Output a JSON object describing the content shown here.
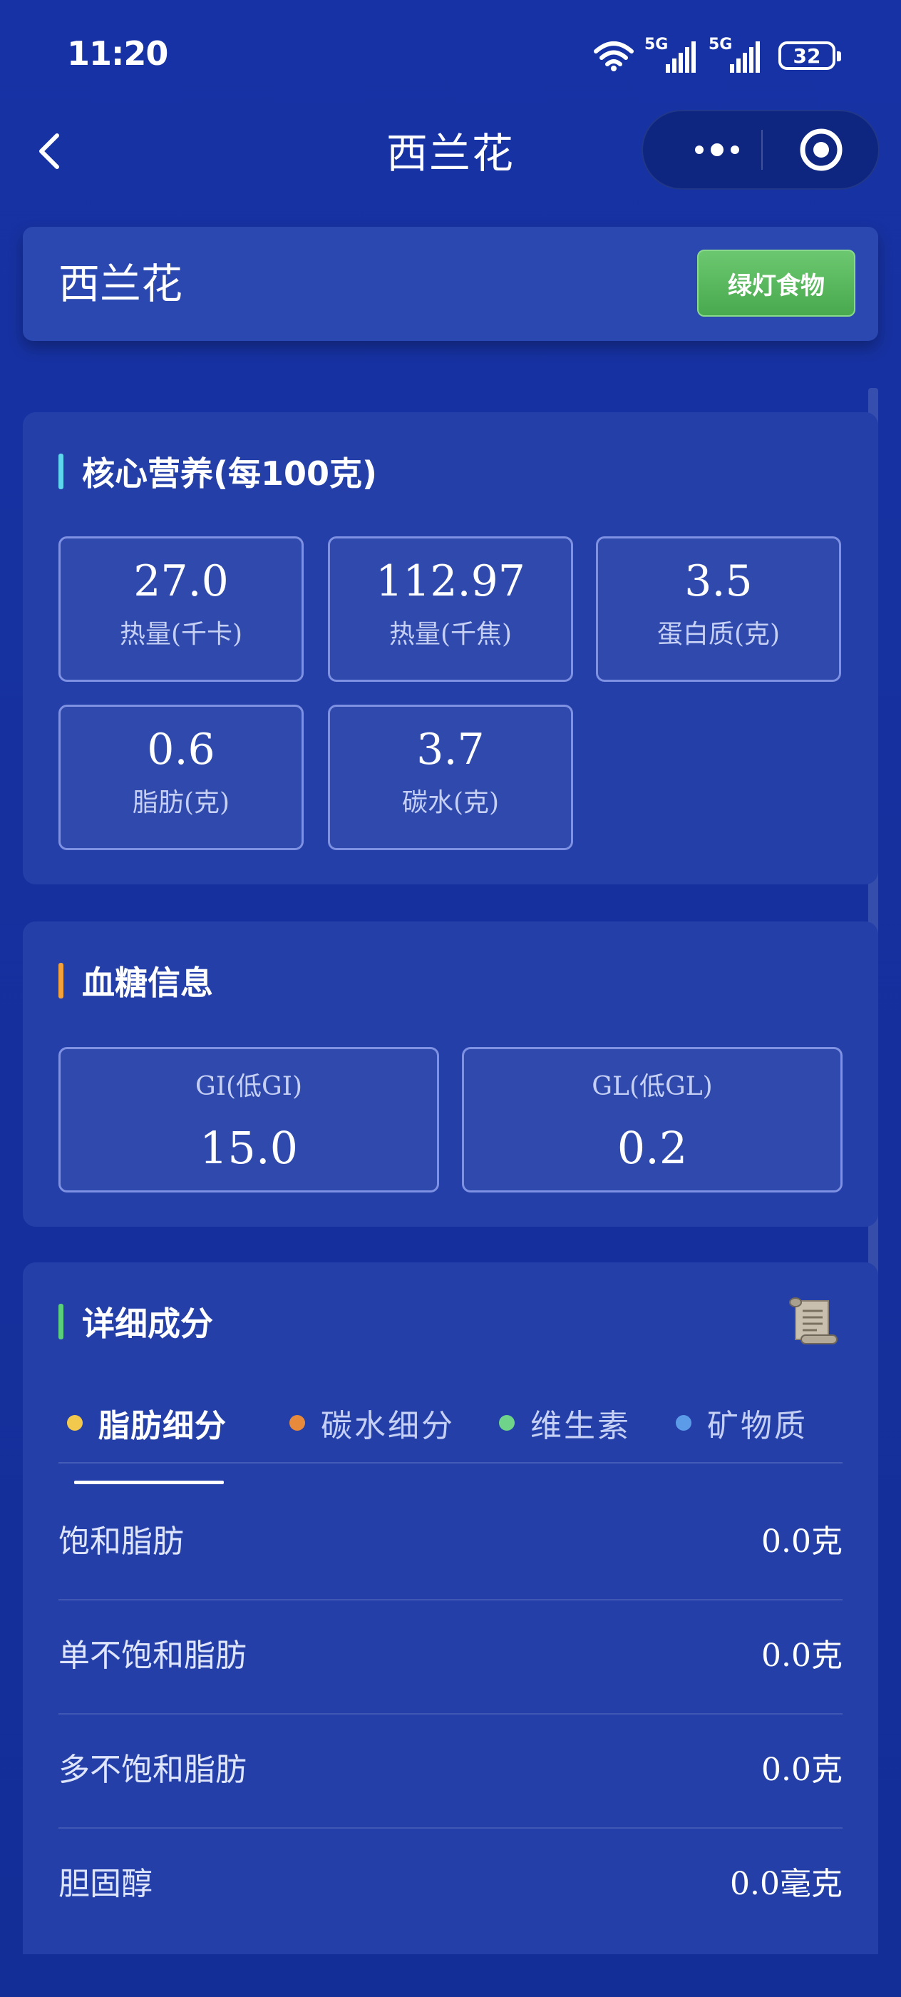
{
  "status_bar": {
    "time": "11:20",
    "signal_1": "5G",
    "signal_2": "5G",
    "battery": "32"
  },
  "nav": {
    "title": "西兰花",
    "back_icon": "chevron-left-icon",
    "more_icon": "more-dots-icon",
    "close_icon": "target-circle-icon"
  },
  "food": {
    "name": "西兰花",
    "tag": "绿灯食物",
    "tag_color": "#5bb85f"
  },
  "core_nutrition": {
    "title": "核心营养(每100克)",
    "accent": "#5fd6ee",
    "items": [
      {
        "value": "27.0",
        "label": "热量(千卡)"
      },
      {
        "value": "112.97",
        "label": "热量(千焦)"
      },
      {
        "value": "3.5",
        "label": "蛋白质(克)"
      },
      {
        "value": "0.6",
        "label": "脂肪(克)"
      },
      {
        "value": "3.7",
        "label": "碳水(克)"
      }
    ]
  },
  "blood_sugar": {
    "title": "血糖信息",
    "accent": "#f2a23c",
    "gi": {
      "label": "GI(低GI)",
      "value": "15.0"
    },
    "gl": {
      "label": "GL(低GL)",
      "value": "0.2"
    }
  },
  "details": {
    "title": "详细成分",
    "accent": "#5ccf7c",
    "icon": "scroll-icon",
    "tabs": [
      {
        "label": "脂肪细分",
        "color": "#f2c94c",
        "active": true
      },
      {
        "label": "碳水细分",
        "color": "#e88a3c",
        "active": false
      },
      {
        "label": "维生素",
        "color": "#6fd38a",
        "active": false
      },
      {
        "label": "矿物质",
        "color": "#5b9be8",
        "active": false
      }
    ],
    "rows": [
      {
        "name": "饱和脂肪",
        "amount": "0.0克"
      },
      {
        "name": "单不饱和脂肪",
        "amount": "0.0克"
      },
      {
        "name": "多不饱和脂肪",
        "amount": "0.0克"
      },
      {
        "name": "胆固醇",
        "amount": "0.0毫克"
      }
    ]
  }
}
